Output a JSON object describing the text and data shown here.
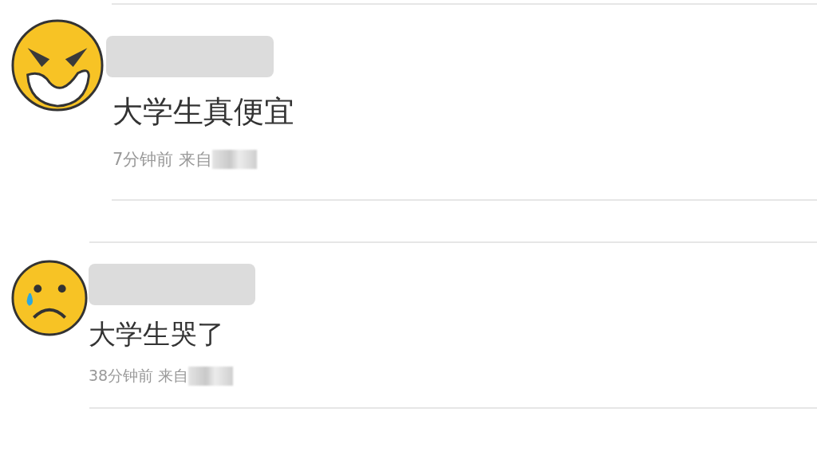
{
  "comments": [
    {
      "kind": "angry",
      "text": "大学生真便宜",
      "meta": "7分钟前 来自"
    },
    {
      "kind": "crying",
      "text": "大学生哭了",
      "meta": "38分钟前 来自"
    }
  ]
}
